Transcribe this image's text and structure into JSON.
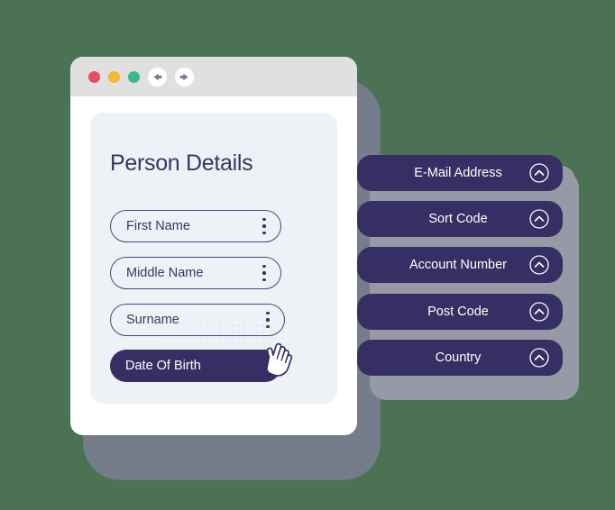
{
  "theme": {
    "background": "#4A7253",
    "shadow": "#757C8A",
    "panel_shadow": "#959AA6",
    "accent_dark": "#372F63",
    "text_dark": "#3B3461",
    "card_background": "#EEF2F7",
    "titlebar": "#E0E0E0",
    "window_background": "#FFFFFF"
  },
  "window": {
    "titlebar": {
      "dots": [
        {
          "name": "close-dot",
          "color": "#EA4C5F"
        },
        {
          "name": "minimize-dot",
          "color": "#F5B731"
        },
        {
          "name": "maximize-dot",
          "color": "#3BB98B"
        }
      ],
      "nav": [
        {
          "name": "back-arrow-icon"
        },
        {
          "name": "forward-arrow-icon"
        }
      ]
    },
    "card": {
      "title": "Person Details",
      "fields": [
        {
          "label": "First Name",
          "menu_icon": "kebab-menu-icon"
        },
        {
          "label": "Middle Name",
          "menu_icon": "kebab-menu-icon"
        },
        {
          "label": "Surname",
          "menu_icon": "kebab-menu-icon"
        }
      ],
      "primary_button": {
        "label": "Date Of Birth",
        "state": "active"
      },
      "cursor": {
        "icon": "hand-pointer-cursor"
      }
    }
  },
  "panels": [
    {
      "label": "E-Mail Address",
      "toggle_icon": "chevron-up-circle-icon"
    },
    {
      "label": "Sort Code",
      "toggle_icon": "chevron-up-circle-icon"
    },
    {
      "label": "Account Number",
      "toggle_icon": "chevron-up-circle-icon"
    },
    {
      "label": "Post Code",
      "toggle_icon": "chevron-up-circle-icon"
    },
    {
      "label": "Country",
      "toggle_icon": "chevron-up-circle-icon"
    }
  ]
}
